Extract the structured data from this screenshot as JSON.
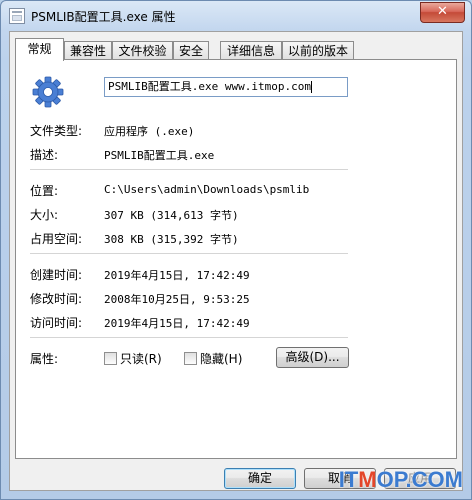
{
  "window": {
    "title": "PSMLIB配置工具.exe 属性",
    "close_label": "✕"
  },
  "tabs": [
    {
      "label": "常规",
      "active": true
    },
    {
      "label": "兼容性",
      "active": false
    },
    {
      "label": "文件校验",
      "active": false
    },
    {
      "label": "安全",
      "active": false
    },
    {
      "label": "详细信息",
      "active": false
    },
    {
      "label": "以前的版本",
      "active": false
    }
  ],
  "general": {
    "file_icon": "gear-icon",
    "file_name": "PSMLIB配置工具.exe www.itmop.com",
    "type_label": "文件类型:",
    "type_value": "应用程序 (.exe)",
    "desc_label": "描述:",
    "desc_value": "PSMLIB配置工具.exe",
    "location_label": "位置:",
    "location_value": "C:\\Users\\admin\\Downloads\\psmlib",
    "size_label": "大小:",
    "size_value": "307 KB (314,613 字节)",
    "disk_label": "占用空间:",
    "disk_value": "308 KB (315,392 字节)",
    "created_label": "创建时间:",
    "created_value": "2019年4月15日, 17:42:49",
    "modified_label": "修改时间:",
    "modified_value": "2008年10月25日, 9:53:25",
    "accessed_label": "访问时间:",
    "accessed_value": "2019年4月15日, 17:42:49",
    "attributes_label": "属性:",
    "readonly_label": "只读(R)",
    "readonly_checked": false,
    "hidden_label": "隐藏(H)",
    "hidden_checked": false,
    "advanced_label": "高级(D)..."
  },
  "buttons": {
    "ok": "确定",
    "cancel": "取消",
    "apply": "应用"
  },
  "watermark": {
    "prefix": "IT",
    "highlight": "M",
    "suffix": "OP.COM"
  },
  "colors": {
    "title_bg": "#c2d6ee",
    "close_red": "#c44a38",
    "gear_blue": "#4a7fd4",
    "watermark_blue": "#3b7bd0",
    "watermark_red": "#e3462a"
  }
}
